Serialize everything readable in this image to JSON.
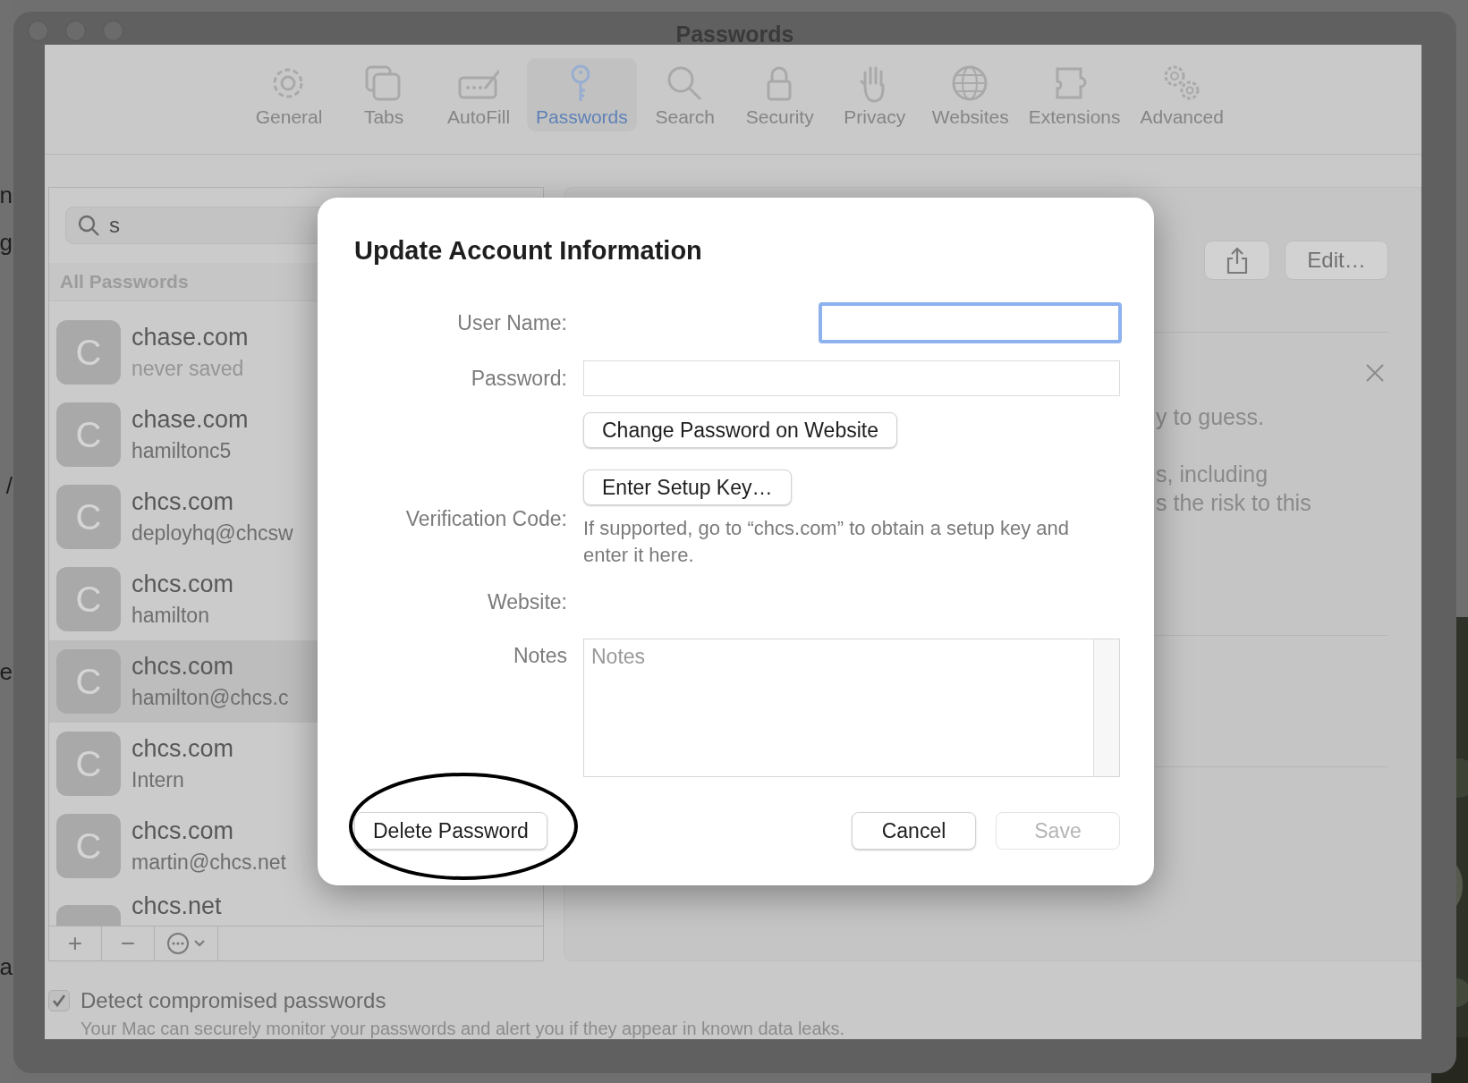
{
  "background_window": {
    "fragments": [
      {
        "text": "n"
      },
      {
        "text": "g"
      },
      {
        "text": "/"
      },
      {
        "text": "e"
      },
      {
        "text": "a"
      }
    ]
  },
  "window": {
    "title": "Passwords"
  },
  "toolbar": [
    {
      "label": "General",
      "kind": "gear",
      "selected": false
    },
    {
      "label": "Tabs",
      "kind": "tabs",
      "selected": false
    },
    {
      "label": "AutoFill",
      "kind": "autofill",
      "selected": false
    },
    {
      "label": "Passwords",
      "kind": "key",
      "selected": true
    },
    {
      "label": "Search",
      "kind": "search",
      "selected": false
    },
    {
      "label": "Security",
      "kind": "lock",
      "selected": false
    },
    {
      "label": "Privacy",
      "kind": "hand",
      "selected": false
    },
    {
      "label": "Websites",
      "kind": "globe",
      "selected": false
    },
    {
      "label": "Extensions",
      "kind": "puzzle",
      "selected": false
    },
    {
      "label": "Advanced",
      "kind": "gears",
      "selected": false
    }
  ],
  "sidebar": {
    "search": {
      "value": "s"
    },
    "section": "All Passwords",
    "items": [
      {
        "initial": "C",
        "site": "chase.com",
        "user": "never saved",
        "muted": true,
        "selected": false
      },
      {
        "initial": "C",
        "site": "chase.com",
        "user": "hamiltonc5",
        "muted": false,
        "selected": false
      },
      {
        "initial": "C",
        "site": "chcs.com",
        "user": "deployhq@chcsw",
        "muted": false,
        "selected": false
      },
      {
        "initial": "C",
        "site": "chcs.com",
        "user": "hamilton",
        "muted": false,
        "selected": false
      },
      {
        "initial": "C",
        "site": "chcs.com",
        "user": "hamilton@chcs.c",
        "muted": false,
        "selected": true
      },
      {
        "initial": "C",
        "site": "chcs.com",
        "user": "Intern",
        "muted": false,
        "selected": false
      },
      {
        "initial": "C",
        "site": "chcs.com",
        "user": "martin@chcs.net",
        "muted": false,
        "selected": false
      },
      {
        "site": "chcs.net",
        "selected": false
      }
    ],
    "bottom_bar": [
      {
        "kind": "add",
        "label": "+"
      },
      {
        "kind": "remove",
        "label": "−"
      },
      {
        "kind": "more"
      }
    ]
  },
  "detail": {
    "edit_button": "Edit…",
    "notice_lines": [
      "y to guess.",
      "s, including",
      "s the risk to this"
    ]
  },
  "detect": {
    "label": "Detect compromised passwords",
    "checked": true,
    "description": "Your Mac can securely monitor your passwords and alert you if they appear in known data leaks."
  },
  "dialog": {
    "title": "Update Account Information",
    "rows": [
      {
        "kind": "input",
        "label": "User Name:",
        "focused": true
      },
      {
        "kind": "input",
        "label": "Password:",
        "focused": false
      },
      {
        "kind": "button",
        "button": "Change Password on Website"
      },
      {
        "kind": "button",
        "label": "Verification Code:",
        "button": "Enter Setup Key…",
        "hint": "If supported, go to “chcs.com” to obtain a setup key and enter it here."
      },
      {
        "kind": "text",
        "label": "Website:"
      },
      {
        "kind": "textarea",
        "label": "Notes",
        "placeholder": "Notes"
      }
    ],
    "delete_button": {
      "label": "Delete Password",
      "circled": true
    },
    "cancel_button": "Cancel",
    "save_button": {
      "label": "Save",
      "disabled": true
    }
  }
}
